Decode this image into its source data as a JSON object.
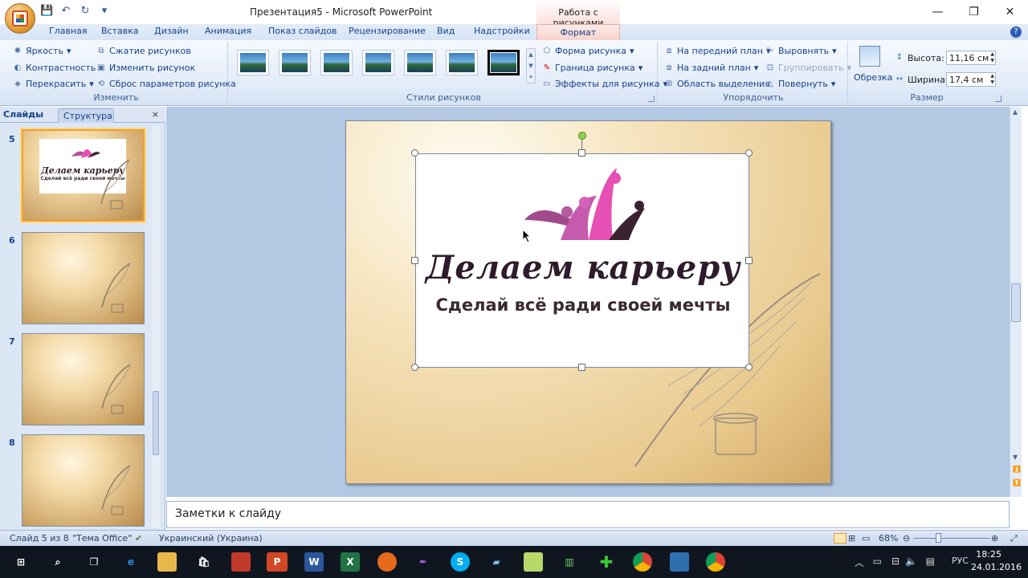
{
  "window": {
    "title": "Презентация5 - Microsoft PowerPoint",
    "context_tool_header": "Работа с рисунками",
    "controls": {
      "minimize": "—",
      "maximize": "❐",
      "close": "✕"
    }
  },
  "ribbon_tabs": [
    "Главная",
    "Вставка",
    "Дизайн",
    "Анимация",
    "Показ слайдов",
    "Рецензирование",
    "Вид",
    "Надстройки",
    "Формат"
  ],
  "active_tab": "Формат",
  "ribbon": {
    "adjust": {
      "label": "Изменить",
      "brightness": "Яркость",
      "contrast": "Контрастность",
      "recolor": "Перекрасить",
      "compress": "Сжатие рисунков",
      "change_picture": "Изменить рисунок",
      "reset": "Сброс параметров рисунка"
    },
    "picture_styles": {
      "label": "Стили рисунков",
      "shape": "Форма рисунка",
      "border": "Граница рисунка",
      "effects": "Эффекты для рисунка"
    },
    "arrange": {
      "label": "Упорядочить",
      "bring_front": "На передний план",
      "send_back": "На задний план",
      "selection_pane": "Область выделения",
      "align": "Выровнять",
      "group": "Группировать",
      "rotate": "Повернуть"
    },
    "size": {
      "label": "Размер",
      "crop": "Обрезка",
      "height_label": "Высота:",
      "height_value": "11,16 см",
      "width_label": "Ширина:",
      "width_value": "17,4 см"
    }
  },
  "left_pane": {
    "tab_slides": "Слайды",
    "tab_outline": "Структура",
    "close": "×",
    "thumbnails": [
      {
        "num": "5",
        "selected": true,
        "has_logo": true
      },
      {
        "num": "6",
        "selected": false,
        "has_logo": false
      },
      {
        "num": "7",
        "selected": false,
        "has_logo": false
      },
      {
        "num": "8",
        "selected": false,
        "has_logo": false
      }
    ],
    "thumb_logo_title": "Делаем карьеру",
    "thumb_logo_subtitle": "Сделай всё ради своей мечты"
  },
  "slide": {
    "logo_title": "Делаем карьеру",
    "logo_subtitle": "Сделай всё ради своей мечты"
  },
  "notes_placeholder": "Заметки к слайду",
  "status": {
    "slide_counter": "Слайд 5 из 8",
    "theme": "\"Тема Office\"",
    "language": "Украинский (Украина)",
    "zoom": "68%"
  },
  "taskbar": {
    "language": "РУС",
    "time": "18:25",
    "date": "24.01.2016"
  },
  "colors": {
    "ribbon_bg": "#dce7f5",
    "format_tab": "#f7d1cb",
    "logo_pink": "#e64fb3",
    "logo_dark": "#2e1b2b"
  }
}
